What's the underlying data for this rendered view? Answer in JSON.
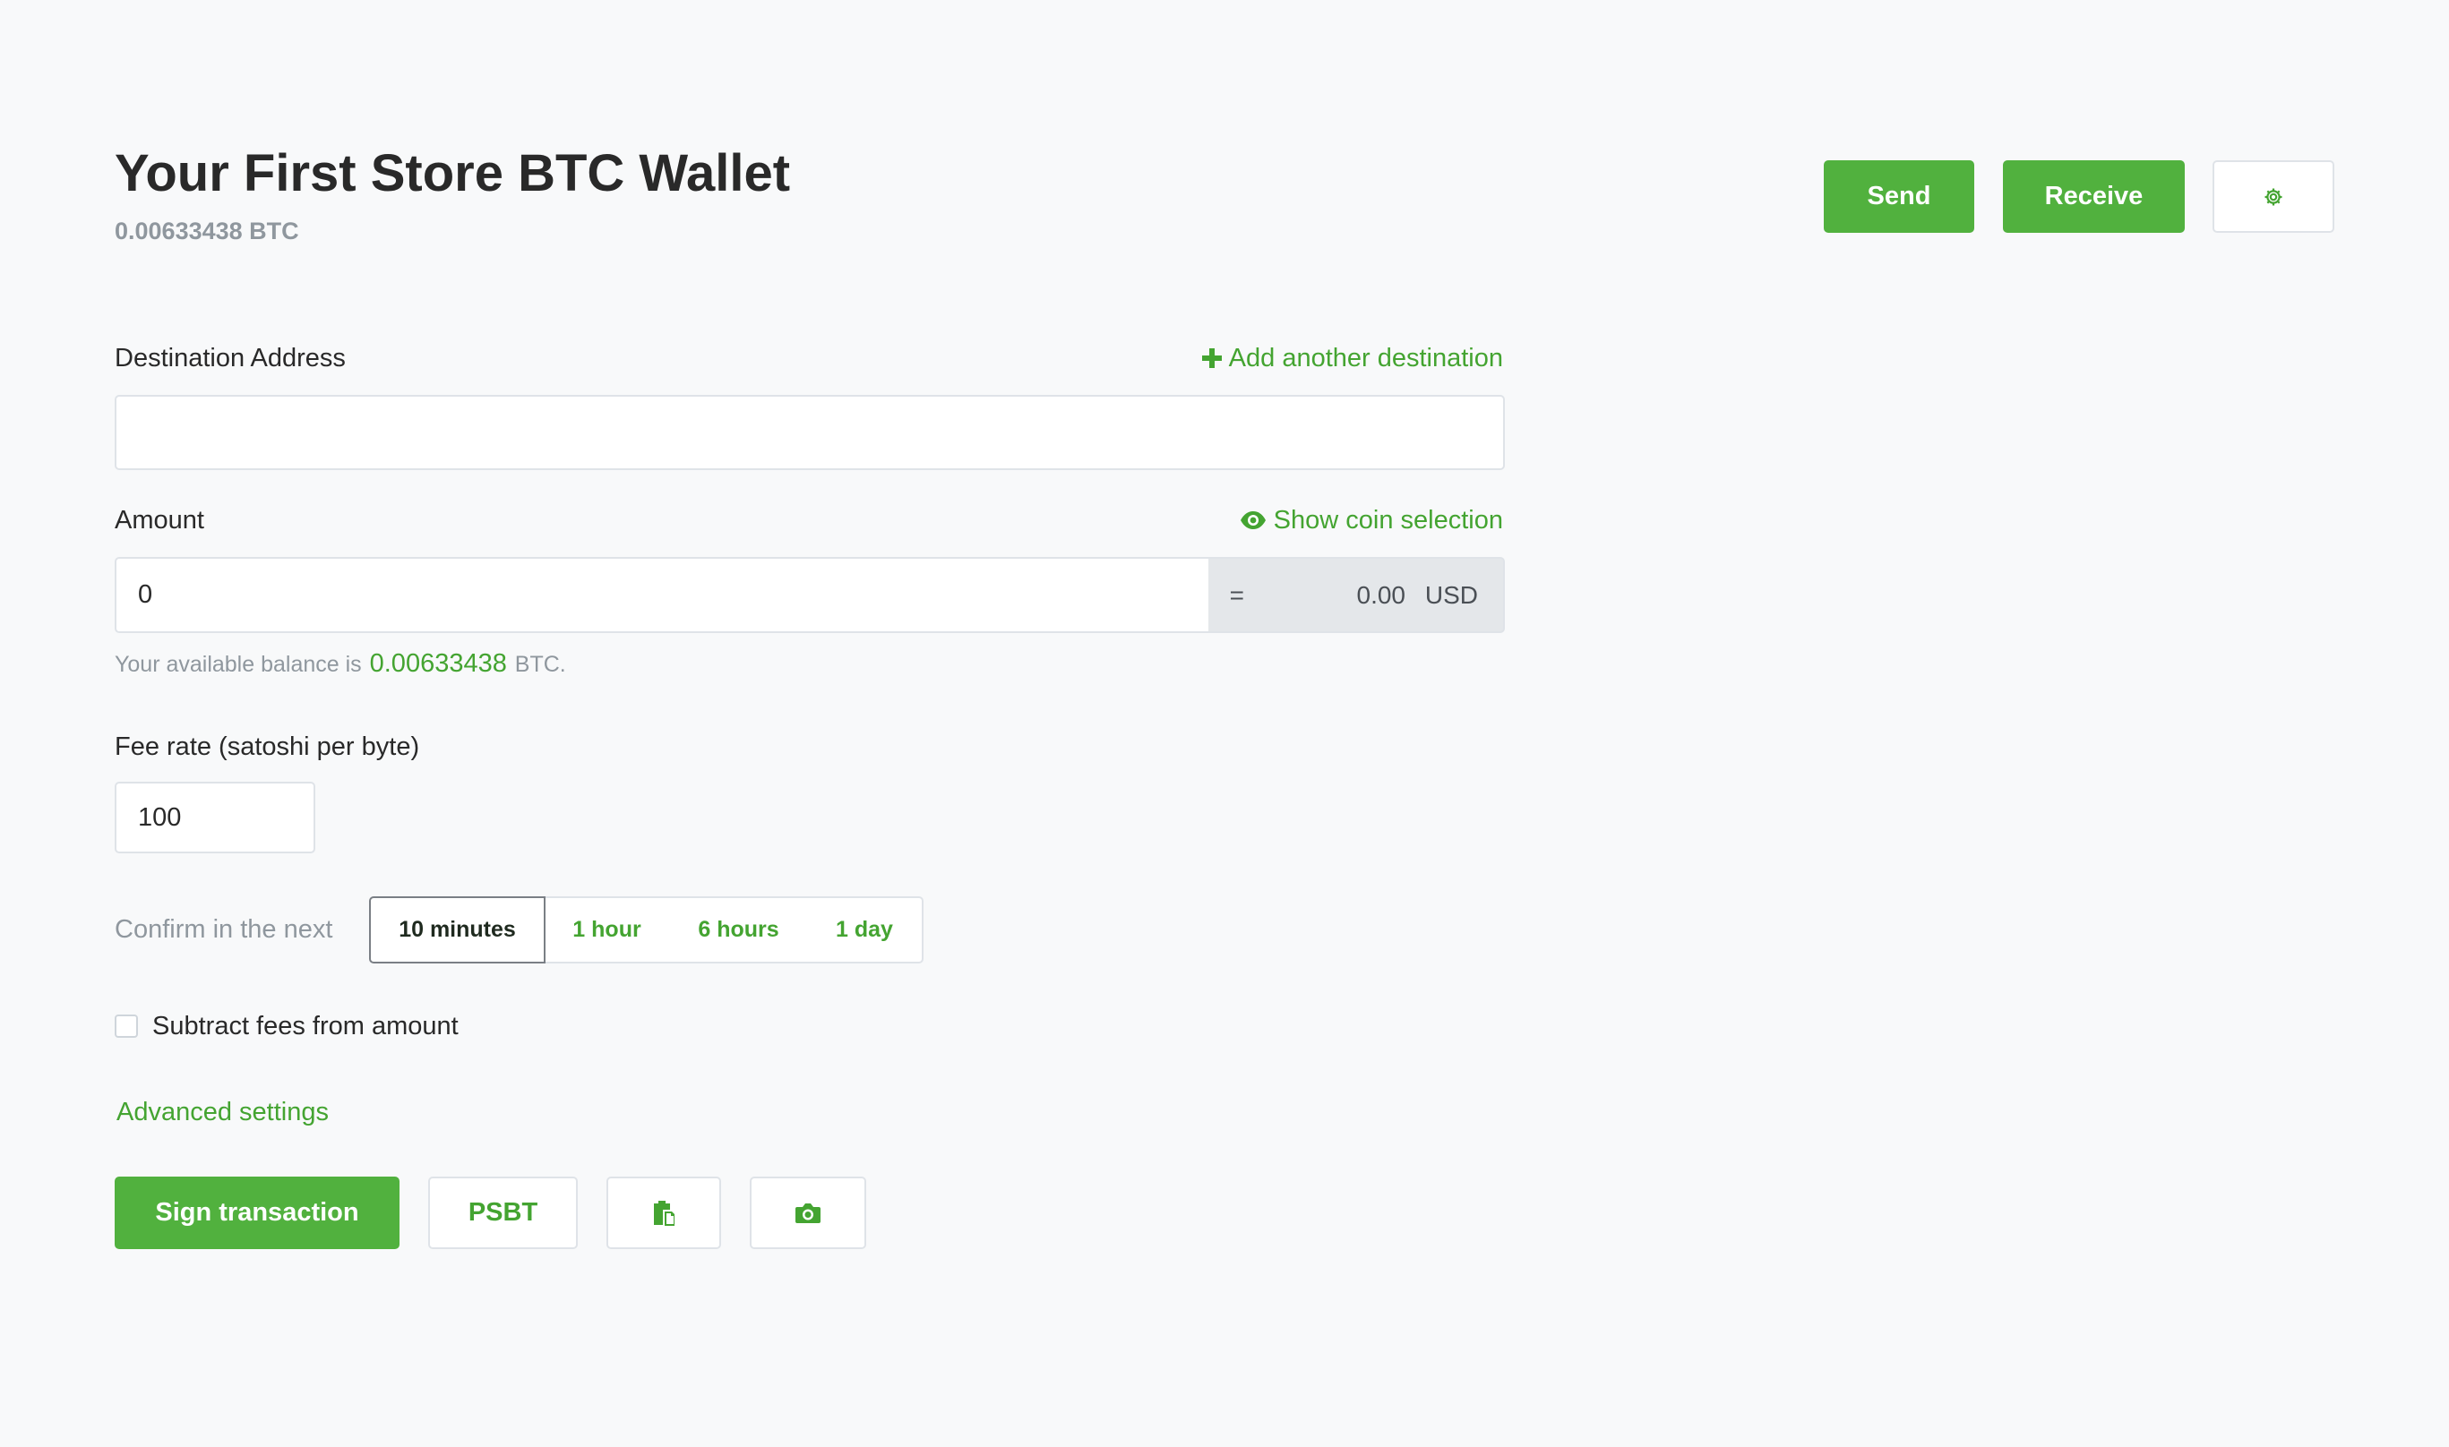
{
  "header": {
    "title": "Your First Store BTC Wallet",
    "balance": "0.00633438 BTC",
    "send_label": "Send",
    "receive_label": "Receive",
    "settings_icon": "gear-icon"
  },
  "destination": {
    "label": "Destination Address",
    "add_link": "Add another destination",
    "add_icon": "plus-icon",
    "value": ""
  },
  "amount": {
    "label": "Amount",
    "coin_link": "Show coin selection",
    "coin_icon": "eye-icon",
    "value": "0",
    "equals": "=",
    "fiat_value": "0.00",
    "fiat_currency": "USD",
    "help_prefix": "Your available balance is",
    "help_balance": "0.00633438",
    "help_suffix": "BTC."
  },
  "fee": {
    "label": "Fee rate (satoshi per byte)",
    "value": "100",
    "confirm_label": "Confirm in the next",
    "options": [
      "10 minutes",
      "1 hour",
      "6 hours",
      "1 day"
    ],
    "selected": "10 minutes"
  },
  "subtract_fees": {
    "label": "Subtract fees from amount",
    "checked": false
  },
  "advanced_link": "Advanced settings",
  "actions": {
    "sign_label": "Sign transaction",
    "psbt_label": "PSBT",
    "paste_icon": "paste-icon",
    "camera_icon": "camera-icon"
  },
  "colors": {
    "accent": "#51b13e",
    "link": "#44a431",
    "background": "#f8f9fa"
  }
}
